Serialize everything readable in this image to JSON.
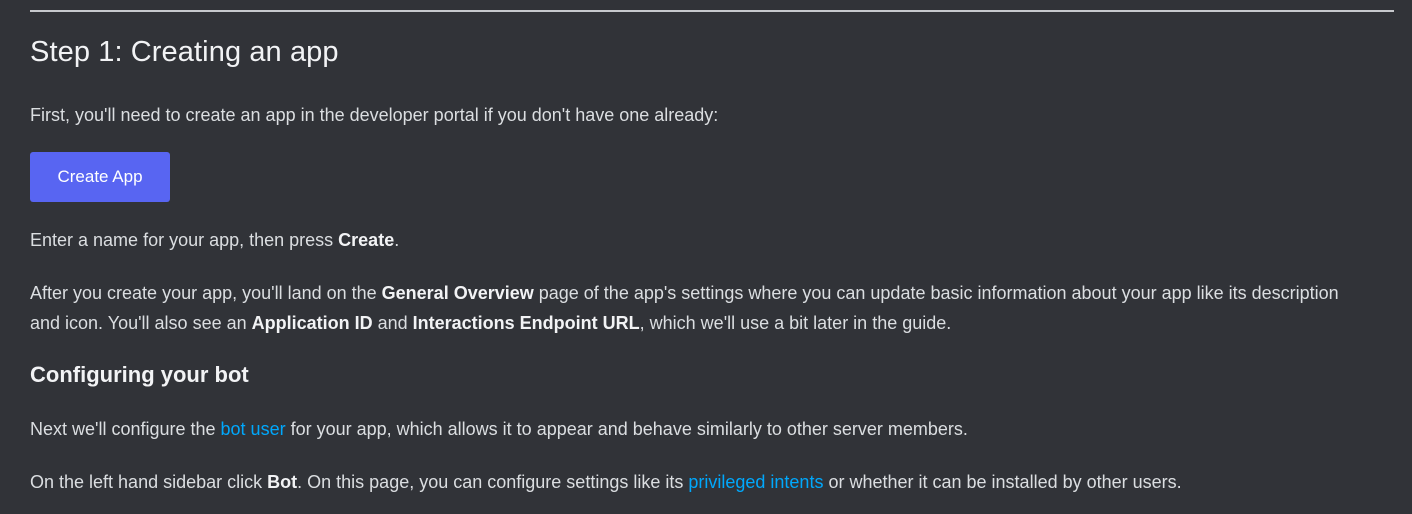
{
  "section": {
    "title": "Step 1: Creating an app",
    "intro": "First, you'll need to create an app in the developer portal if you don't have one already:",
    "create_button_label": "Create App",
    "enter_name": {
      "before": "Enter a name for your app, then press ",
      "bold": "Create",
      "after": "."
    },
    "after_create": {
      "t1": "After you create your app, you'll land on the ",
      "b1": "General Overview",
      "t2": " page of the app's settings where you can update basic information about your app like its description and icon. You'll also see an ",
      "b2": "Application ID",
      "t3": " and ",
      "b3": "Interactions Endpoint URL",
      "t4": ", which we'll use a bit later in the guide."
    }
  },
  "bot_section": {
    "title": "Configuring your bot",
    "configure": {
      "before": "Next we'll configure the ",
      "link": "bot user",
      "after": " for your app, which allows it to appear and behave similarly to other server members."
    },
    "sidebar": {
      "before": "On the left hand sidebar click ",
      "bold": "Bot",
      "middle": ". On this page, you can configure settings like its ",
      "link": "privileged intents",
      "after": " or whether it can be installed by other users."
    }
  },
  "colors": {
    "background": "#313338",
    "button": "#5865f2",
    "link": "#00a8fc"
  }
}
